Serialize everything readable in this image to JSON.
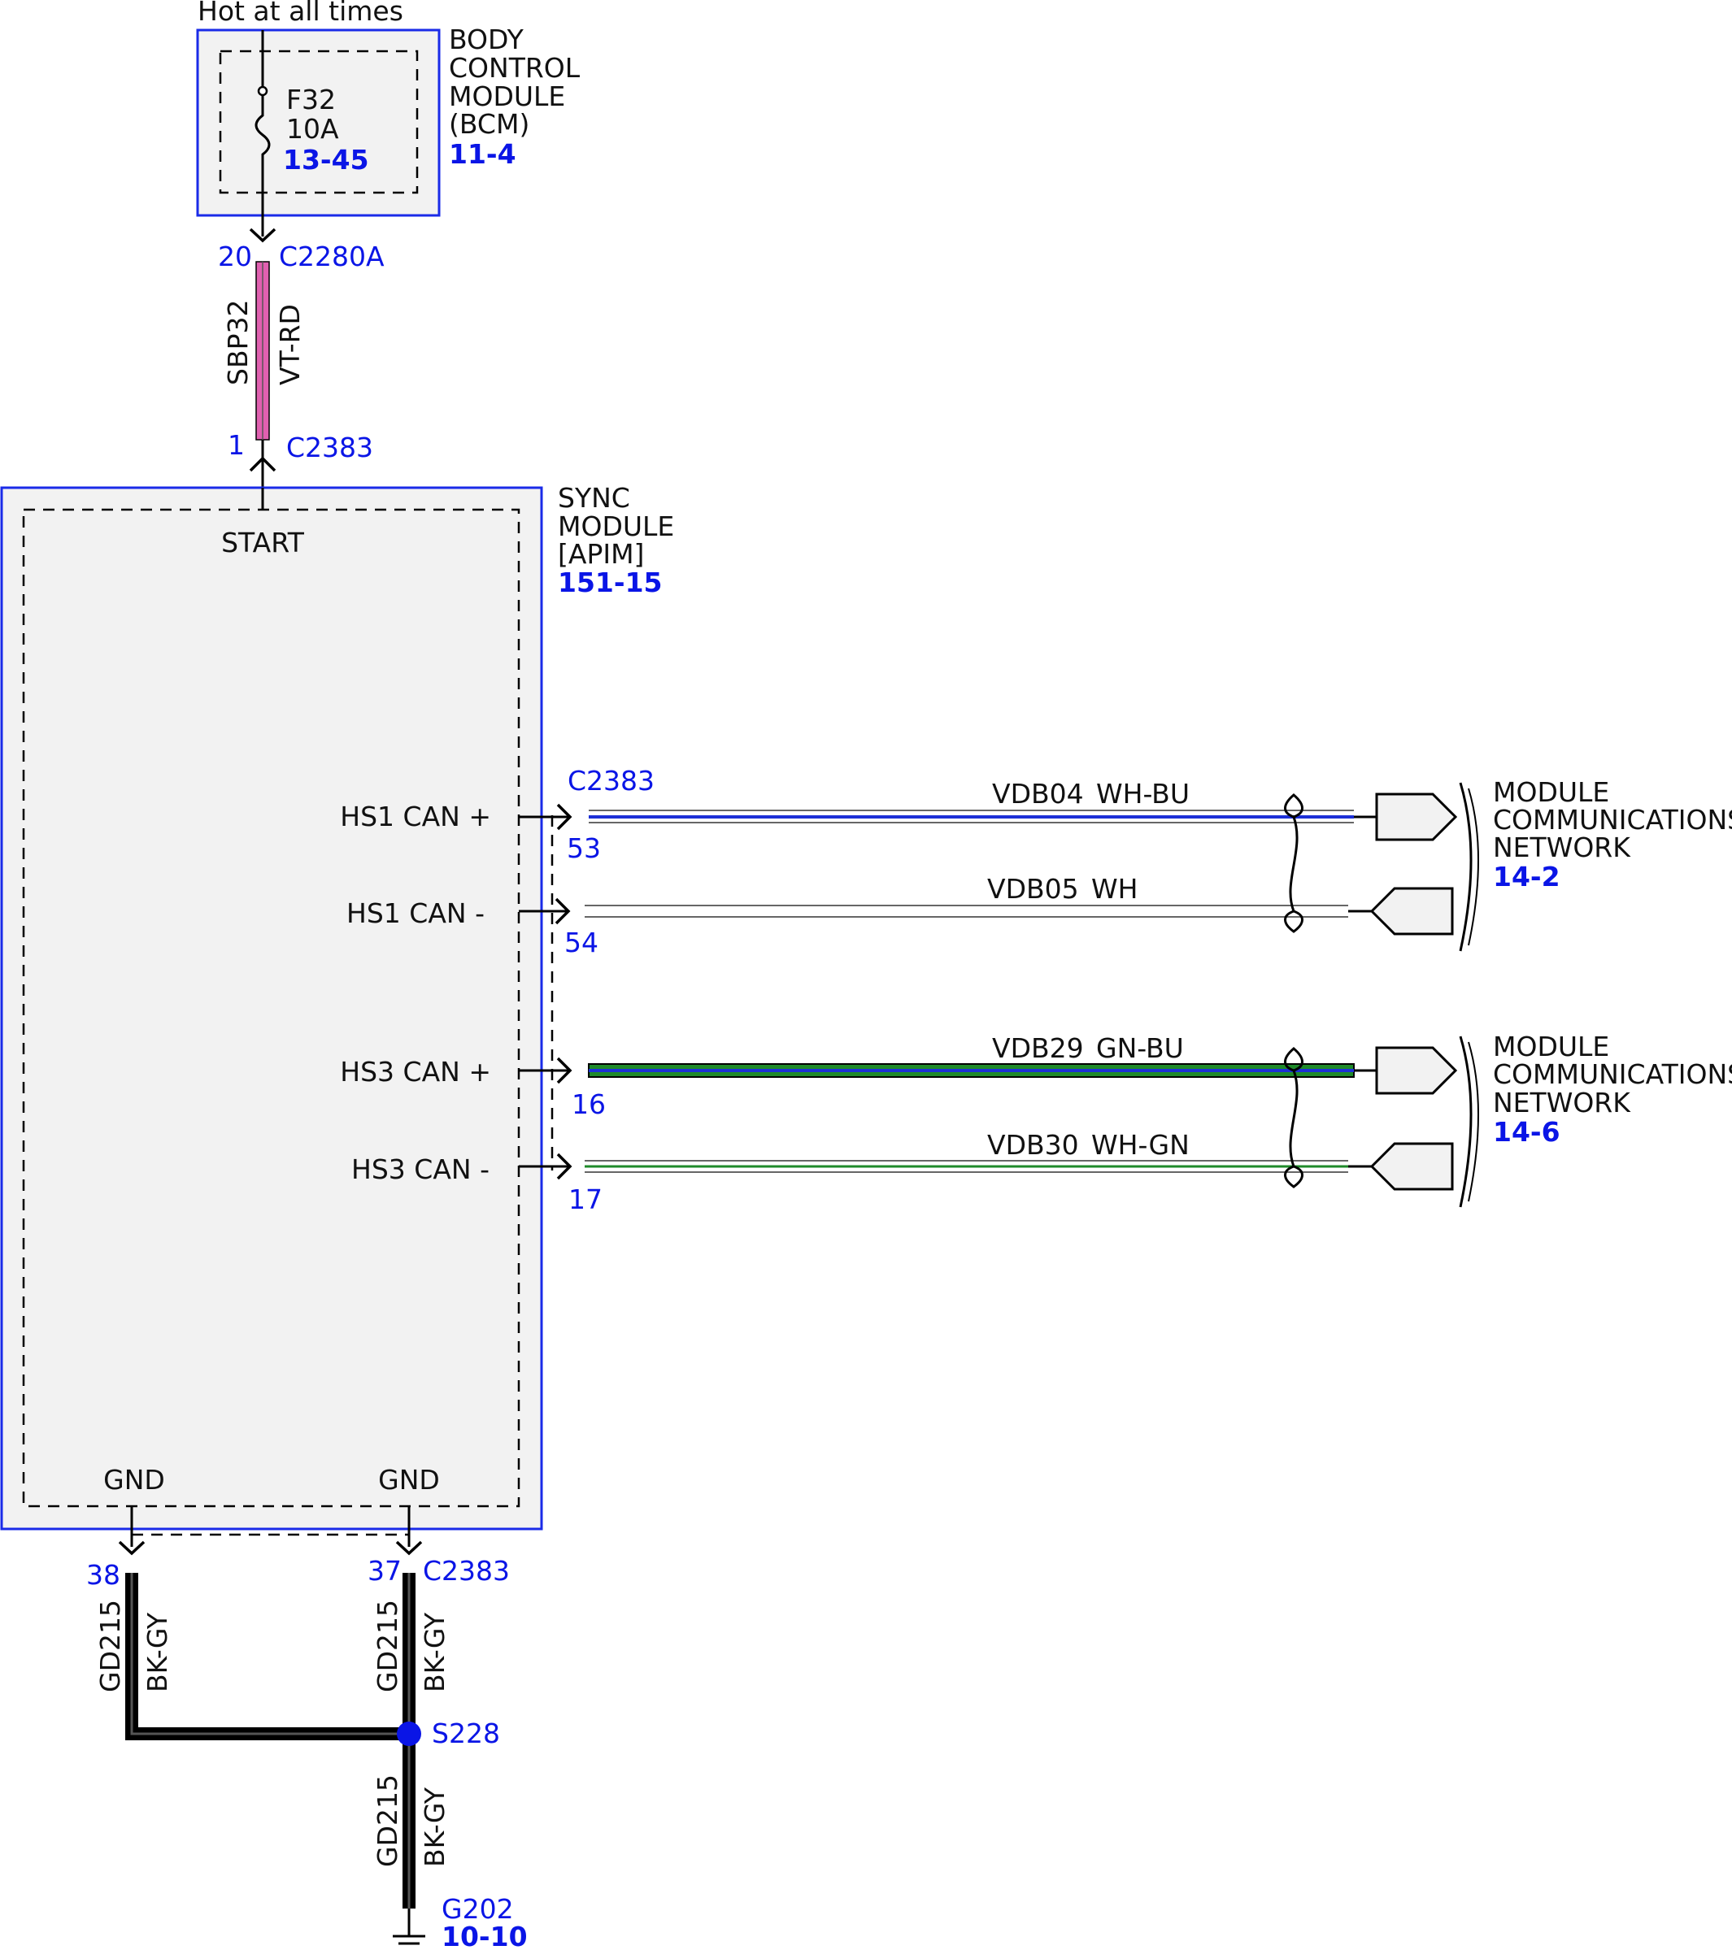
{
  "supply": {
    "label": "Hot at all times"
  },
  "bcm": {
    "title_lines": [
      "BODY",
      "CONTROL",
      "MODULE",
      "(BCM)"
    ],
    "ref": "11-4",
    "fuse": {
      "name": "F32",
      "rating": "10A",
      "ref": "13-45"
    }
  },
  "bcm_connector": {
    "pin": "20",
    "name": "C2280A"
  },
  "feed_wire": {
    "circuit": "SBP32",
    "color": "VT-RD"
  },
  "sync_connector_top": {
    "pin": "1",
    "name": "C2383"
  },
  "sync": {
    "title_lines": [
      "SYNC",
      "MODULE",
      "[APIM]"
    ],
    "ref": "151-15",
    "start_label": "START",
    "gnd_left_label": "GND",
    "gnd_right_label": "GND"
  },
  "can_connector": "C2383",
  "can_lines": [
    {
      "label": "HS1 CAN +",
      "pin": "53",
      "circuit": "VDB04",
      "color": "WH-BU"
    },
    {
      "label": "HS1 CAN -",
      "pin": "54",
      "circuit": "VDB05",
      "color": "WH"
    },
    {
      "label": "HS3 CAN +",
      "pin": "16",
      "circuit": "VDB29",
      "color": "GN-BU"
    },
    {
      "label": "HS3 CAN -",
      "pin": "17",
      "circuit": "VDB30",
      "color": "WH-GN"
    }
  ],
  "networks": [
    {
      "lines": [
        "MODULE",
        "COMMUNICATIONS",
        "NETWORK"
      ],
      "ref": "14-2"
    },
    {
      "lines": [
        "MODULE",
        "COMMUNICATIONS",
        "NETWORK"
      ],
      "ref": "14-6"
    }
  ],
  "ground_left": {
    "pin": "38",
    "circuit": "GD215",
    "color": "BK-GY"
  },
  "ground_right": {
    "pin": "37",
    "connector": "C2383",
    "circuit": "GD215",
    "color": "BK-GY"
  },
  "splice": {
    "name": "S228"
  },
  "ground_wire": {
    "circuit": "GD215",
    "color": "BK-GY"
  },
  "ground_point": {
    "name": "G202",
    "ref": "10-10"
  },
  "colors": {
    "link_blue": "#0a15e6",
    "module_fill": "#f2f2f2",
    "violet_red": "#e060b0",
    "blue": "#1c2fd6",
    "green": "#1f8a2a",
    "black": "#000000"
  }
}
